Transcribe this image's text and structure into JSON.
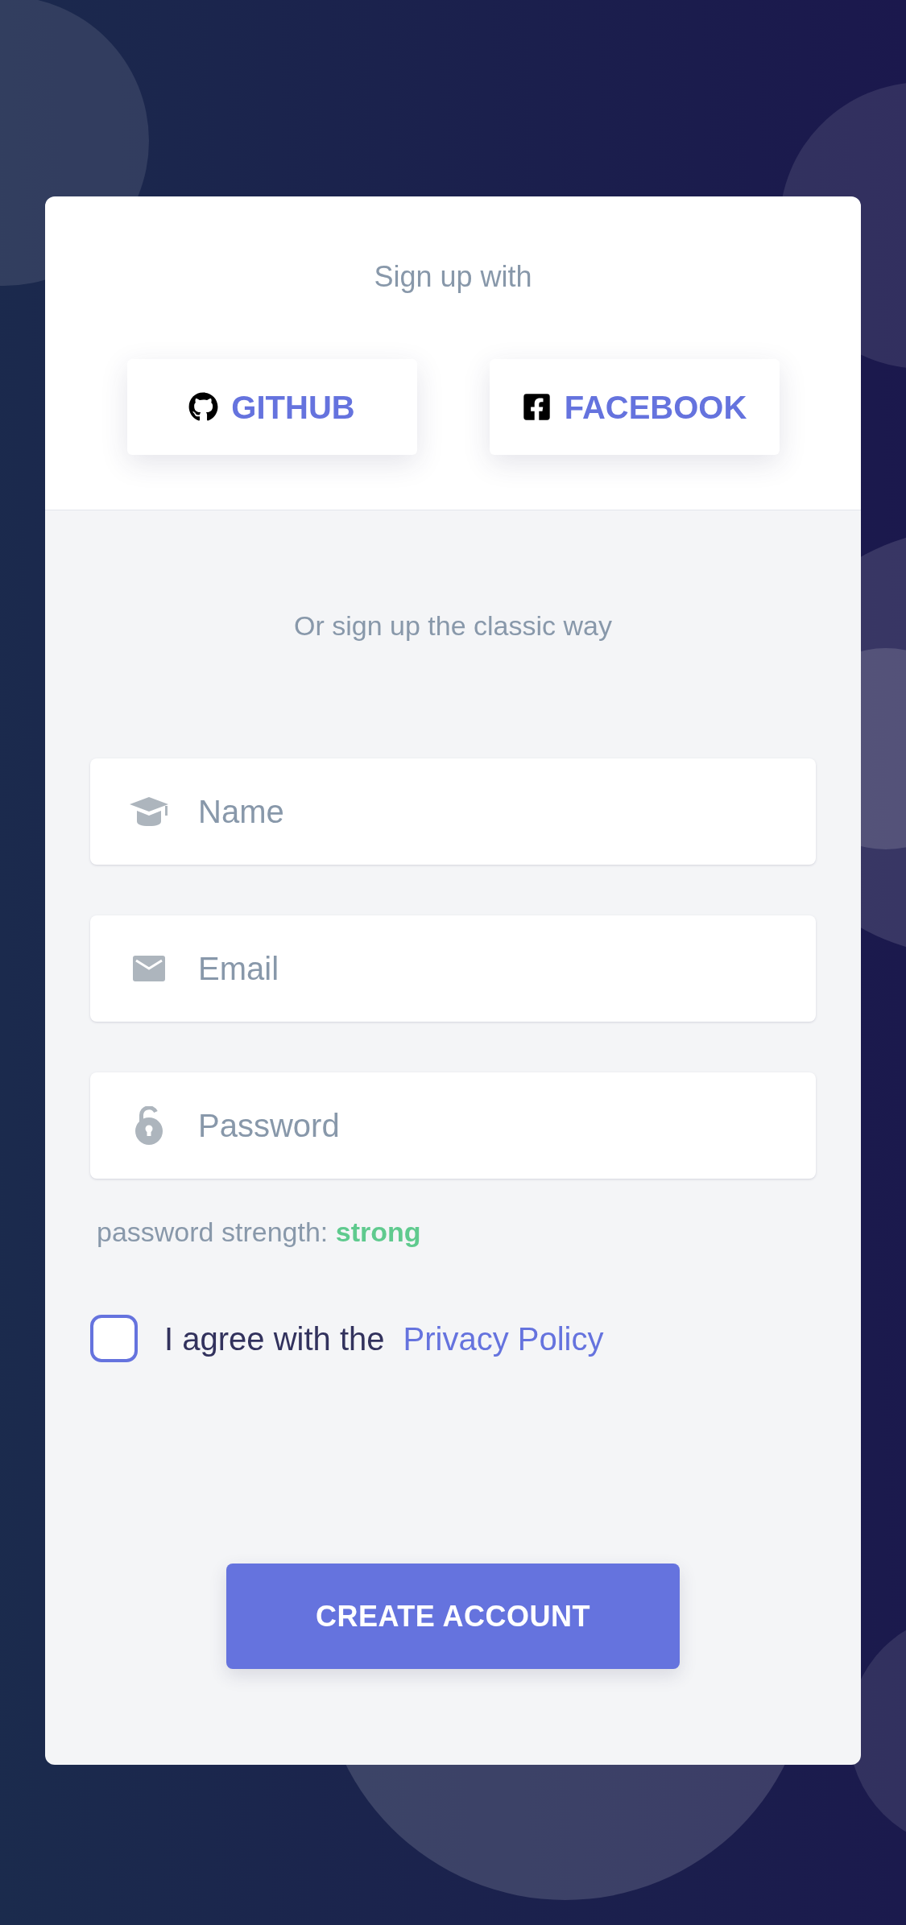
{
  "social_signup": {
    "title": "Sign up with",
    "buttons": [
      {
        "kind": "github",
        "label": "GITHUB"
      },
      {
        "kind": "facebook",
        "label": "FACEBOOK"
      }
    ]
  },
  "classic_signup": {
    "title": "Or sign up the classic way",
    "fields": [
      {
        "kind": "name",
        "placeholder": "Name"
      },
      {
        "kind": "email",
        "placeholder": "Email"
      },
      {
        "kind": "password",
        "placeholder": "Password"
      }
    ],
    "password_strength": {
      "label": "password strength:",
      "value": "strong"
    },
    "agreement": {
      "checked": false,
      "text": "I agree with the",
      "link": "Privacy Policy"
    },
    "submit": "CREATE ACCOUNT"
  }
}
